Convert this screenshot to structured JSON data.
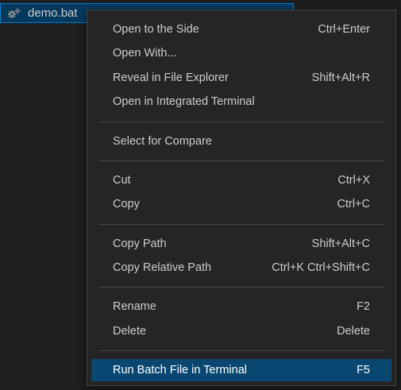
{
  "explorer": {
    "file": {
      "name": "demo.bat",
      "icon": "gear-icon"
    }
  },
  "context_menu": {
    "items": [
      {
        "label": "Open to the Side",
        "shortcut": "Ctrl+Enter"
      },
      {
        "label": "Open With...",
        "shortcut": ""
      },
      {
        "label": "Reveal in File Explorer",
        "shortcut": "Shift+Alt+R"
      },
      {
        "label": "Open in Integrated Terminal",
        "shortcut": ""
      },
      {
        "label": "Select for Compare",
        "shortcut": ""
      },
      {
        "label": "Cut",
        "shortcut": "Ctrl+X"
      },
      {
        "label": "Copy",
        "shortcut": "Ctrl+C"
      },
      {
        "label": "Copy Path",
        "shortcut": "Shift+Alt+C"
      },
      {
        "label": "Copy Relative Path",
        "shortcut": "Ctrl+K Ctrl+Shift+C"
      },
      {
        "label": "Rename",
        "shortcut": "F2"
      },
      {
        "label": "Delete",
        "shortcut": "Delete"
      },
      {
        "label": "Run Batch File in Terminal",
        "shortcut": "F5"
      }
    ],
    "selected_item": "Run Batch File in Terminal"
  },
  "colors": {
    "background": "#1e1e1e",
    "menu_background": "#252526",
    "selection": "#094771",
    "file_row_selection": "#04395e",
    "focus_border": "#007fd4",
    "text": "#cccccc"
  }
}
